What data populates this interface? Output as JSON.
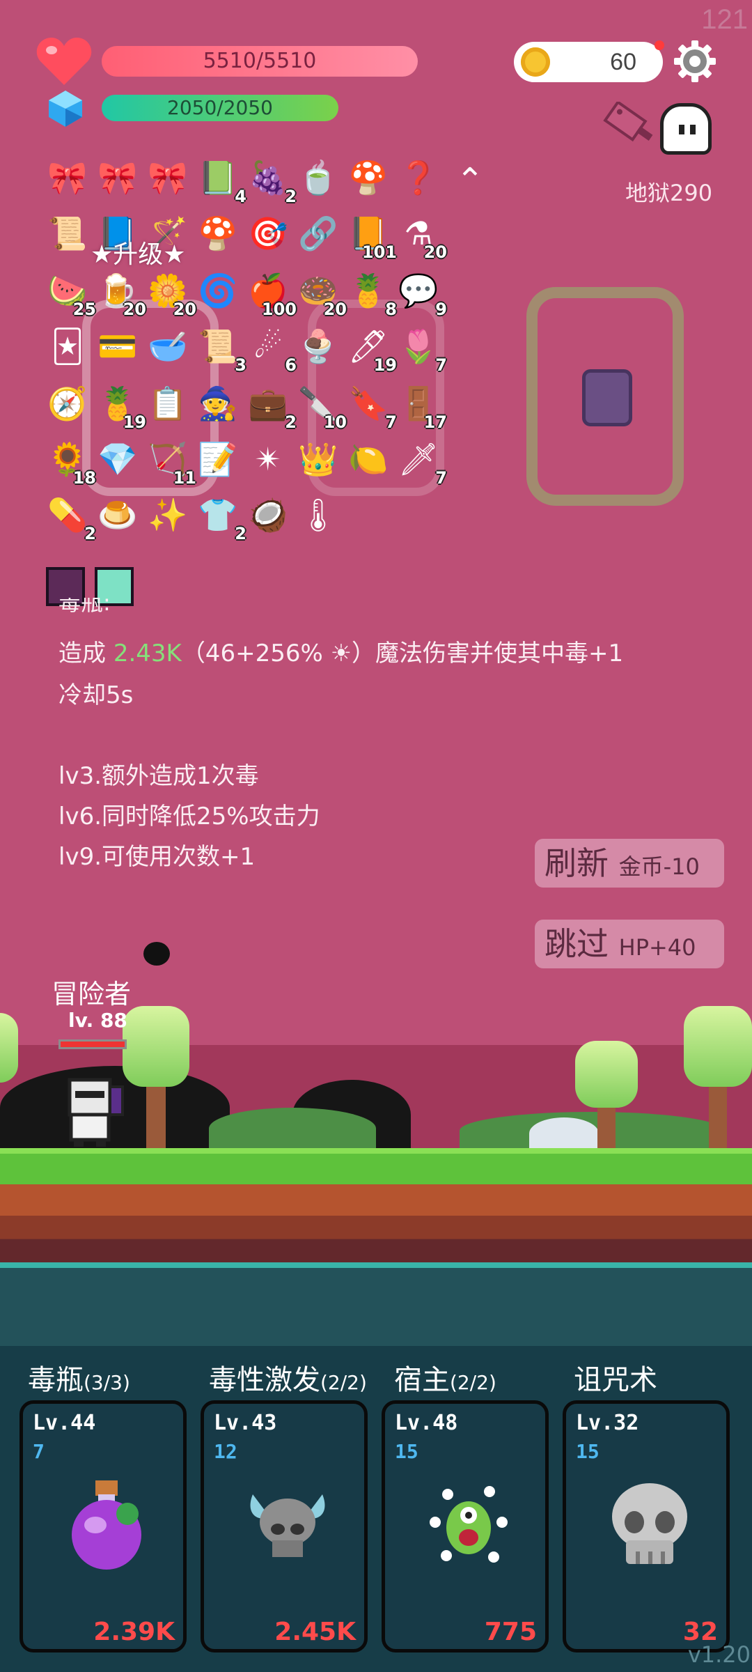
{
  "corner_counter": "121",
  "hp": {
    "text": "5510/5510"
  },
  "mp": {
    "text": "2050/2050"
  },
  "coins": {
    "value": "60"
  },
  "stage": {
    "label": "地狱290"
  },
  "items": [
    {
      "icon": "🎀",
      "count": ""
    },
    {
      "icon": "🎀",
      "count": ""
    },
    {
      "icon": "🎀",
      "count": ""
    },
    {
      "icon": "📗",
      "count": "4"
    },
    {
      "icon": "🍇",
      "count": "2"
    },
    {
      "icon": "🍵",
      "count": ""
    },
    {
      "icon": "🍄",
      "count": ""
    },
    {
      "icon": "❓",
      "count": ""
    },
    {
      "icon": "📜",
      "count": ""
    },
    {
      "icon": "📘",
      "count": ""
    },
    {
      "icon": "🪄",
      "count": ""
    },
    {
      "icon": "🍄",
      "count": ""
    },
    {
      "icon": "🎯",
      "count": ""
    },
    {
      "icon": "🔗",
      "count": ""
    },
    {
      "icon": "📙",
      "count": "101"
    },
    {
      "icon": "⚗",
      "count": "20"
    },
    {
      "icon": "🍉",
      "count": "25"
    },
    {
      "icon": "🍺",
      "count": "20"
    },
    {
      "icon": "🌼",
      "count": "20"
    },
    {
      "icon": "🌀",
      "count": ""
    },
    {
      "icon": "🍎",
      "count": "100"
    },
    {
      "icon": "🍩",
      "count": "20"
    },
    {
      "icon": "🍍",
      "count": "8"
    },
    {
      "icon": "💬",
      "count": "9"
    },
    {
      "icon": "🃏",
      "count": ""
    },
    {
      "icon": "💳",
      "count": ""
    },
    {
      "icon": "🥣",
      "count": ""
    },
    {
      "icon": "📜",
      "count": "3"
    },
    {
      "icon": "☄",
      "count": "6"
    },
    {
      "icon": "🍨",
      "count": ""
    },
    {
      "icon": "🖊",
      "count": "19"
    },
    {
      "icon": "🌷",
      "count": "7"
    },
    {
      "icon": "🧭",
      "count": ""
    },
    {
      "icon": "🍍",
      "count": "19"
    },
    {
      "icon": "📋",
      "count": ""
    },
    {
      "icon": "🧙",
      "count": ""
    },
    {
      "icon": "💼",
      "count": "2"
    },
    {
      "icon": "🔪",
      "count": "10"
    },
    {
      "icon": "🔖",
      "count": "7"
    },
    {
      "icon": "🚪",
      "count": "17"
    },
    {
      "icon": "🌻",
      "count": "18"
    },
    {
      "icon": "💎",
      "count": ""
    },
    {
      "icon": "🏹",
      "count": "11"
    },
    {
      "icon": "📝",
      "count": ""
    },
    {
      "icon": "✴",
      "count": ""
    },
    {
      "icon": "👑",
      "count": ""
    },
    {
      "icon": "🍋",
      "count": ""
    },
    {
      "icon": "🗡",
      "count": "7"
    },
    {
      "icon": "💊",
      "count": "2"
    },
    {
      "icon": "🍮",
      "count": ""
    },
    {
      "icon": "✨",
      "count": ""
    },
    {
      "icon": "👕",
      "count": "2"
    },
    {
      "icon": "🥥",
      "count": ""
    },
    {
      "icon": "🌡",
      "count": ""
    }
  ],
  "upgrade_label": "升级",
  "description": {
    "title_fragment": "毒瓶:",
    "line1_prefix": "造成 ",
    "line1_value": "2.43K",
    "line1_suffix": "（46+256% ☀）魔法伤害并使其中毒+1",
    "line2": "冷却5s",
    "line3": "lv3.额外造成1次毒",
    "line4": "lv6.同时降低25%攻击力",
    "line5": "lv9.可使用次数+1"
  },
  "buttons": {
    "refresh": {
      "label": "刷新",
      "cost": "金币-10"
    },
    "skip": {
      "label": "跳过",
      "cost": "HP+40"
    }
  },
  "hero": {
    "name": "冒险者",
    "level": "lv. 88"
  },
  "skills": [
    {
      "title": "毒瓶",
      "count": "(3/3)",
      "level": "Lv.44",
      "num": "7",
      "damage": "2.39K",
      "icon": "potion-icon"
    },
    {
      "title": "毒性激发",
      "count": "(2/2)",
      "level": "Lv.43",
      "num": "12",
      "damage": "2.45K",
      "icon": "horned-skull-icon"
    },
    {
      "title": "宿主",
      "count": "(2/2)",
      "level": "Lv.48",
      "num": "15",
      "damage": "775",
      "icon": "green-monster-icon"
    },
    {
      "title": "诅咒术",
      "count": "",
      "level": "Lv.32",
      "num": "15",
      "damage": "32",
      "icon": "skull-icon"
    }
  ],
  "version": "v1.20",
  "colors": {
    "background": "#bd4f76",
    "panel": "#173d48",
    "damage": "#ff4b4b",
    "accent_blue": "#4fb8f0"
  }
}
